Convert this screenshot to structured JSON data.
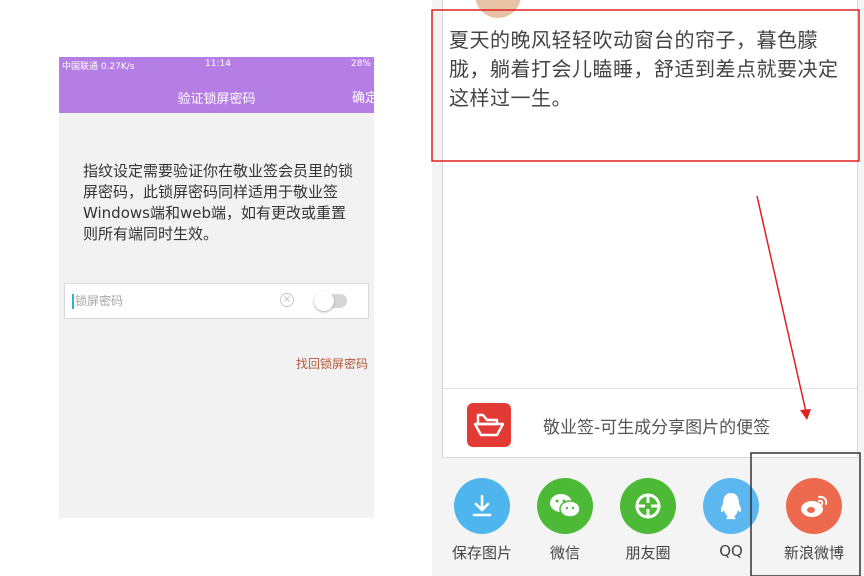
{
  "phone": {
    "status_left": "中国联通 0.27K/s",
    "status_time": "11:14",
    "status_battery": "28%",
    "title": "验证锁屏密码",
    "confirm": "确定",
    "description": "指纹设定需要验证你在敬业签会员里的锁屏密码，此锁屏密码同样适用于敬业签Windows端和web端，如有更改或重置则所有端同时生效。",
    "password_placeholder": "锁屏密码",
    "password_value": "",
    "visibility_toggle_on": false,
    "recover_link": "找回锁屏密码",
    "colors": {
      "header": "#b57ee4",
      "link": "#b2573c"
    }
  },
  "share": {
    "note_text": "夏天的晚风轻轻吹动窗台的帘子，暮色朦胧，躺着打会儿瞌睡，舒适到差点就要决定这样过一生。",
    "app_tagline": "敬业签-可生成分享图片的便签",
    "targets": [
      {
        "label": "保存图片",
        "icon": "download-icon",
        "color": "#4fb5ef"
      },
      {
        "label": "微信",
        "icon": "wechat-icon",
        "color": "#4cba36"
      },
      {
        "label": "朋友圈",
        "icon": "moments-icon",
        "color": "#4cba36"
      },
      {
        "label": "QQ",
        "icon": "qq-icon",
        "color": "#5cb6f0"
      },
      {
        "label": "新浪微博",
        "icon": "weibo-icon",
        "color": "#ee6a4e"
      }
    ]
  }
}
